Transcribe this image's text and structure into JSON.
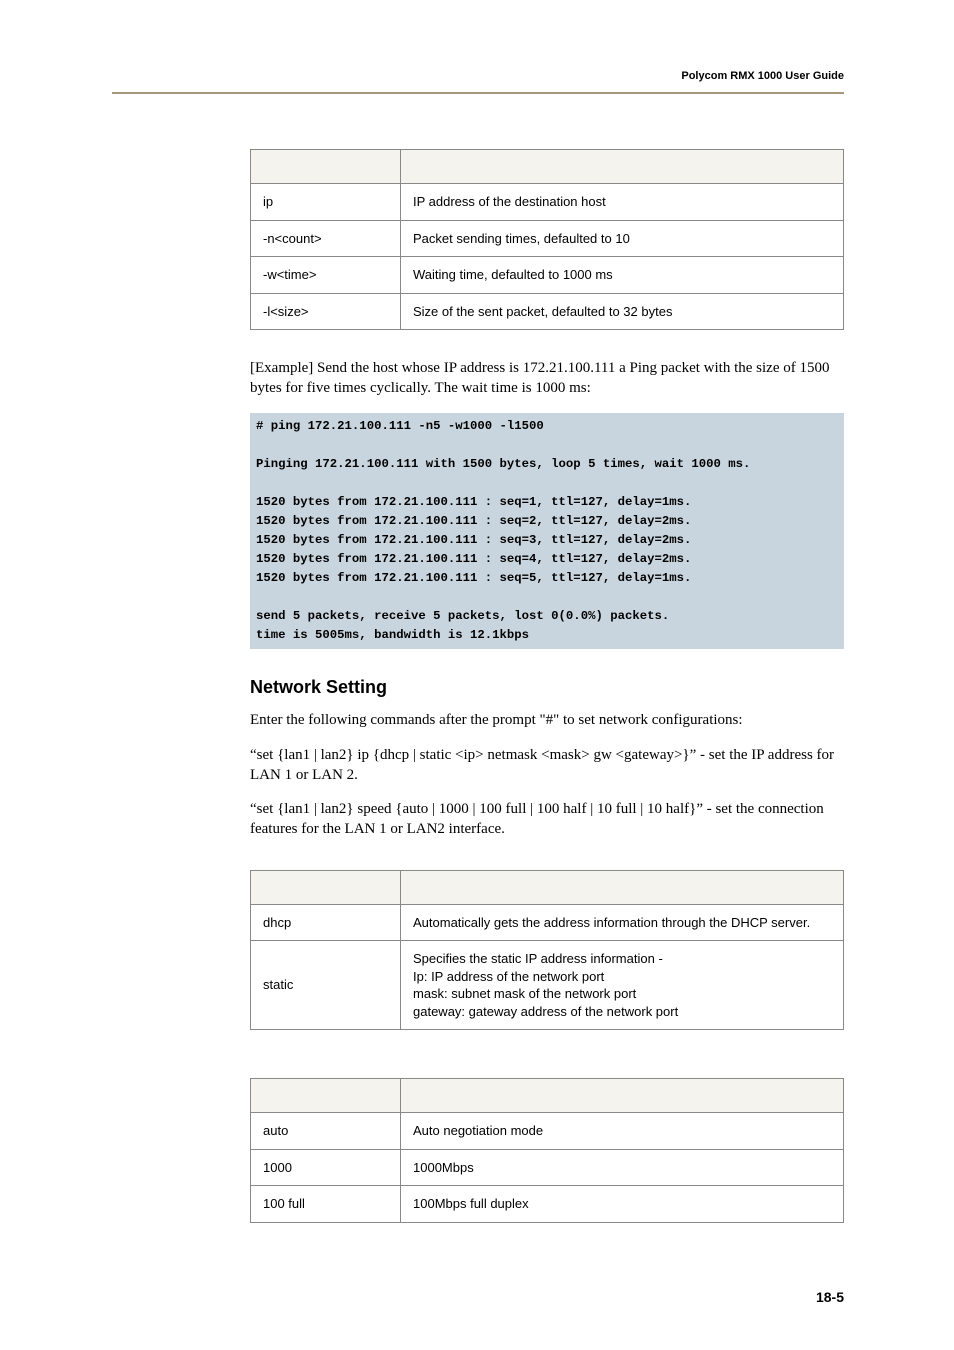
{
  "header": {
    "title": "Polycom RMX 1000 User Guide"
  },
  "table1": {
    "rows": [
      {
        "k": "ip",
        "v": "IP address of the destination host"
      },
      {
        "k": "-n<count>",
        "v": "Packet sending times, defaulted to 10"
      },
      {
        "k": "-w<time>",
        "v": "Waiting time, defaulted to 1000 ms"
      },
      {
        "k": "-l<size>",
        "v": "Size of the sent packet, defaulted to 32 bytes"
      }
    ]
  },
  "example_intro": "[Example] Send the host whose IP address is 172.21.100.111 a Ping packet with the size of 1500 bytes for five times cyclically. The wait time is 1000 ms:",
  "terminal": "# ping 172.21.100.111 -n5 -w1000 -l1500\n\nPinging 172.21.100.111 with 1500 bytes, loop 5 times, wait 1000 ms.\n\n1520 bytes from 172.21.100.111 : seq=1, ttl=127, delay=1ms.\n1520 bytes from 172.21.100.111 : seq=2, ttl=127, delay=2ms.\n1520 bytes from 172.21.100.111 : seq=3, ttl=127, delay=2ms.\n1520 bytes from 172.21.100.111 : seq=4, ttl=127, delay=2ms.\n1520 bytes from 172.21.100.111 : seq=5, ttl=127, delay=1ms.\n\nsend 5 packets, receive 5 packets, lost 0(0.0%) packets.\ntime is 5005ms, bandwidth is 12.1kbps",
  "section_heading": "Network Setting",
  "net_p1": "Enter the following commands after the prompt \"#\" to set network configurations:",
  "net_p2": "“set {lan1 | lan2} ip {dhcp | static <ip> netmask <mask> gw <gateway>}” - set the IP address for LAN 1 or LAN 2.",
  "net_p3": "“set {lan1 | lan2} speed {auto | 1000 | 100 full | 100 half | 10 full | 10 half}” - set the connection features for the LAN 1 or LAN2 interface.",
  "table2": {
    "rows": [
      {
        "k": "dhcp",
        "v": "Automatically gets the address information through the DHCP server."
      },
      {
        "k": "static",
        "v": "Specifies the static IP address information -\nIp: IP address of the network port\nmask: subnet mask of the network port\ngateway: gateway address of the network port"
      }
    ]
  },
  "table3": {
    "rows": [
      {
        "k": "auto",
        "v": "Auto negotiation mode"
      },
      {
        "k": "1000",
        "v": "1000Mbps"
      },
      {
        "k": "100 full",
        "v": "100Mbps full duplex"
      }
    ]
  },
  "page_number": "18-5"
}
